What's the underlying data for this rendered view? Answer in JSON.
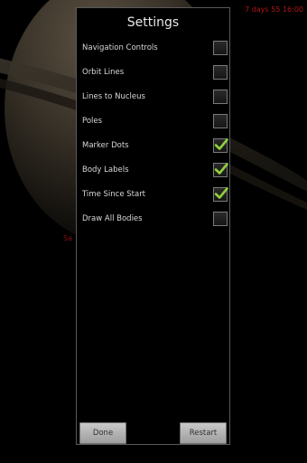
{
  "background": {
    "time_readout": "7 days 55 16:00",
    "body_label": "Sa"
  },
  "dialog": {
    "title": "Settings",
    "options": [
      {
        "label": "Navigation Controls",
        "checked": false
      },
      {
        "label": "Orbit Lines",
        "checked": false
      },
      {
        "label": "Lines to Nucleus",
        "checked": false
      },
      {
        "label": "Poles",
        "checked": false
      },
      {
        "label": "Marker Dots",
        "checked": true
      },
      {
        "label": "Body Labels",
        "checked": true
      },
      {
        "label": "Time Since Start",
        "checked": true
      },
      {
        "label": "Draw All Bodies",
        "checked": false
      }
    ],
    "done_label": "Done",
    "restart_label": "Restart"
  },
  "colors": {
    "check_mark": "#8fd13c",
    "overlay_text": "#b01515"
  }
}
